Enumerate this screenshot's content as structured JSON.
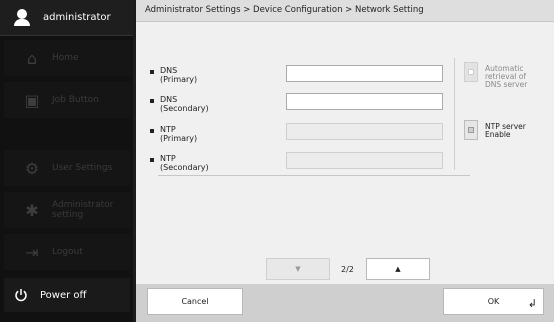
{
  "user": {
    "name": "administrator",
    "icon": "user-icon"
  },
  "nav": [
    {
      "label": "Home",
      "icon": "home-icon"
    },
    {
      "label": "Job Button",
      "icon": "job-button-icon"
    },
    {
      "label": "User Settings",
      "icon": "user-settings-icon"
    },
    {
      "label": "Administrator setting",
      "icon": "administrator-setting-icon"
    },
    {
      "label": "Logout",
      "icon": "logout-icon"
    }
  ],
  "power": {
    "label": "Power off",
    "icon": "power-icon"
  },
  "breadcrumb": "Administrator Settings > Device Configuration > Network Setting",
  "fields": [
    {
      "label": "DNS\n(Primary)",
      "value": "",
      "enabled": true
    },
    {
      "label": "DNS\n(Secondary)",
      "value": "",
      "enabled": true
    },
    {
      "label": "NTP\n(Primary)",
      "value": "",
      "enabled": false
    },
    {
      "label": "NTP\n(Secondary)",
      "value": "",
      "enabled": false
    }
  ],
  "options": {
    "auto_dns": {
      "label": "Automatic\nretrieval of\nDNS server",
      "enabled": false
    },
    "ntp_enable": {
      "label": "NTP server\nEnable",
      "enabled": true
    }
  },
  "pager": {
    "text": "2/2",
    "up_icon": "triangle-up-icon",
    "down_icon": "triangle-down-icon"
  },
  "buttons": {
    "cancel": "Cancel",
    "ok": "OK",
    "enter_icon": "enter-icon"
  }
}
